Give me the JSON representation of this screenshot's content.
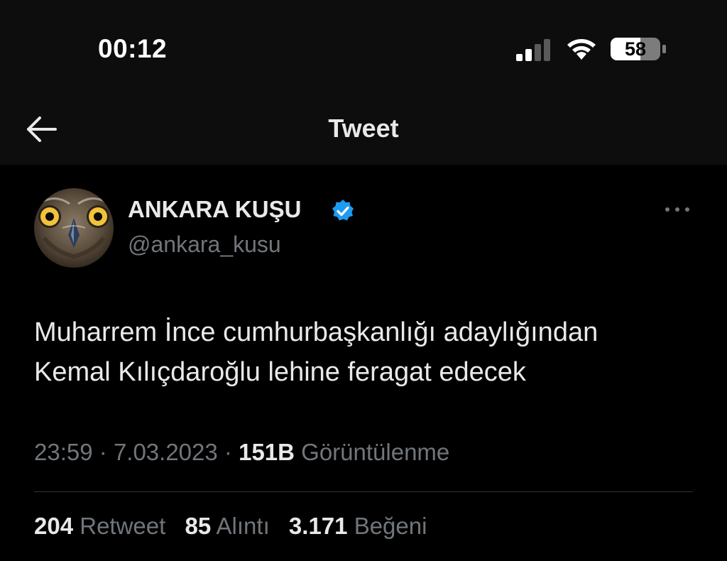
{
  "status_bar": {
    "time": "00:12",
    "battery": "58",
    "icons": [
      "signal-icon",
      "wifi-icon",
      "battery-icon"
    ]
  },
  "nav": {
    "back_icon": "arrow-left-icon",
    "title": "Tweet"
  },
  "tweet": {
    "author": {
      "name": "ANKARA KUŞU",
      "handle": "@ankara_kusu",
      "verified": true,
      "avatar": "owl-avatar"
    },
    "more_icon": "more-horizontal-icon",
    "text_line1": "Muharrem İnce cumhurbaşkanlığı adaylığından",
    "text_line2": "Kemal Kılıçdaroğlu lehine feragat edecek",
    "time": "23:59",
    "date": "7.03.2023",
    "separator": "·",
    "views_count": "151B",
    "views_label": "Görüntülenme",
    "stats": {
      "retweets": "204",
      "retweets_label": "Retweet",
      "quotes": "85",
      "quotes_label": "Alıntı",
      "likes": "3.171",
      "likes_label": "Beğeni"
    }
  },
  "colors": {
    "background": "#000000",
    "top_bar": "#0d0d0d",
    "primary_text": "#e7e9ea",
    "secondary_text": "#71767b",
    "verified_blue": "#1d9bf0",
    "divider": "#2f3336"
  }
}
